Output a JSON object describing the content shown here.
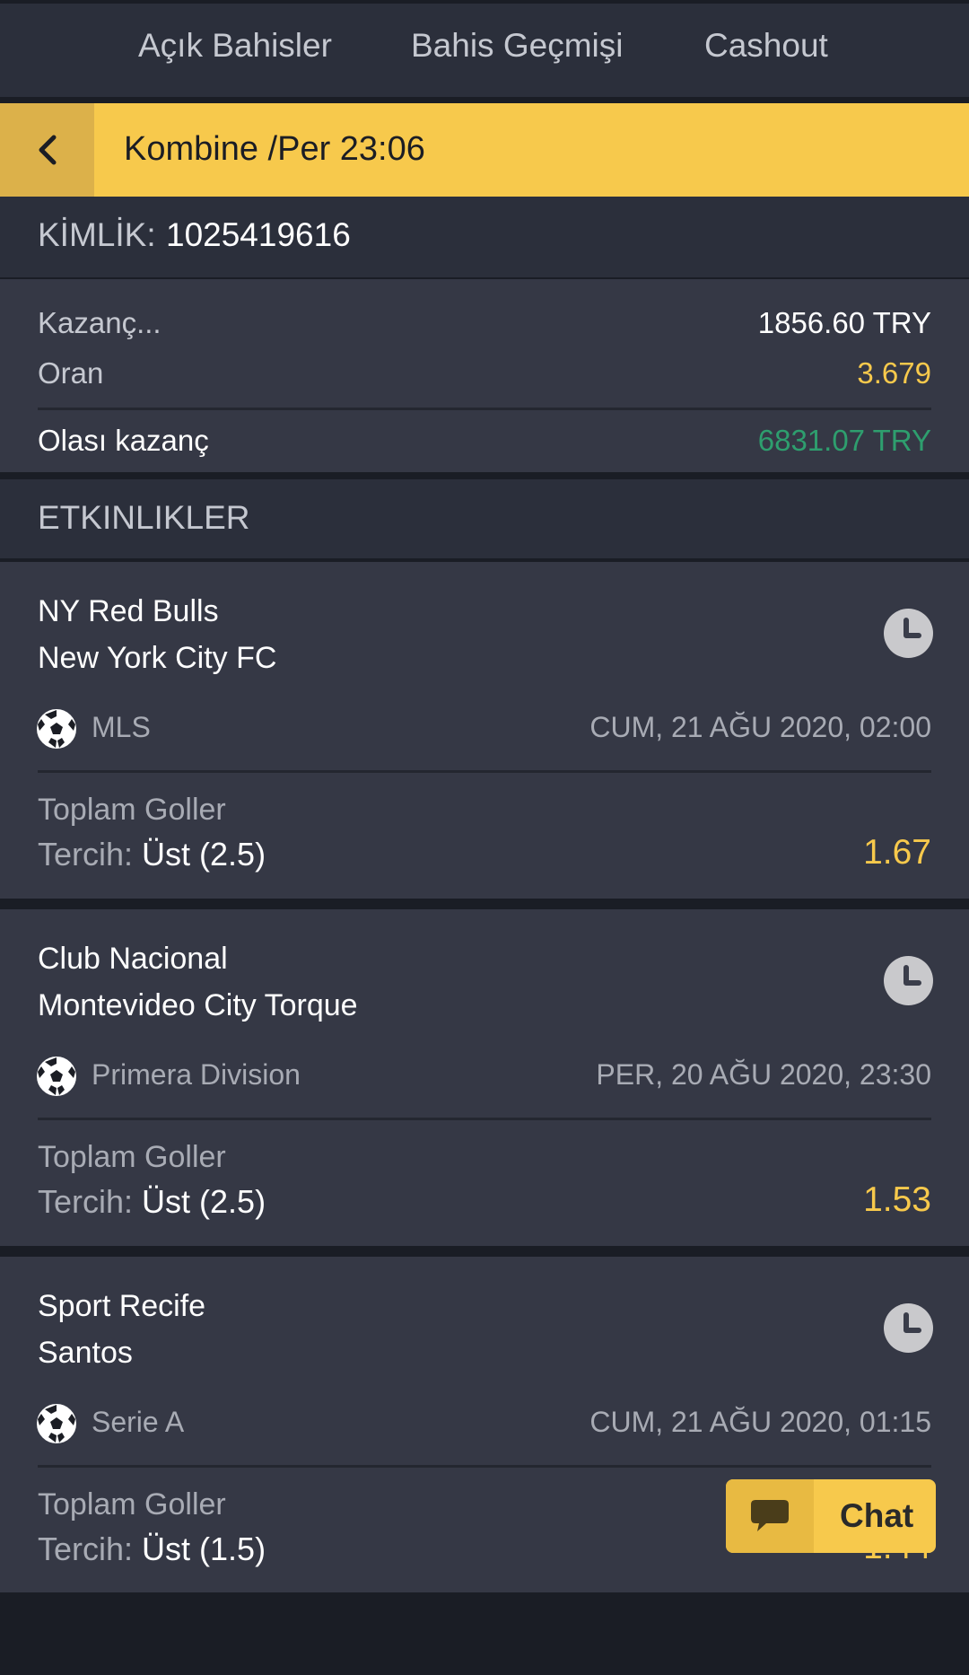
{
  "tabs": [
    "Açık Bahisler",
    "Bahis Geçmişi",
    "Cashout"
  ],
  "header": {
    "title": "Kombine /Per 23:06"
  },
  "id_row": {
    "label": "KİMLİK:",
    "value": "1025419616"
  },
  "summary": {
    "stake_label": "Kazanç...",
    "stake_value": "1856.60 TRY",
    "odds_label": "Oran",
    "odds_value": "3.679",
    "potential_label": "Olası kazanç",
    "potential_value": "6831.07 TRY"
  },
  "events_title": "ETKINLIKLER",
  "pick_prefix": "Tercih:",
  "events": [
    {
      "home": "NY Red Bulls",
      "away": "New York City FC",
      "league": "MLS",
      "date": "CUM, 21 AĞU 2020, 02:00",
      "market": "Toplam Goller",
      "pick": "Üst (2.5)",
      "odds": "1.67"
    },
    {
      "home": "Club Nacional",
      "away": "Montevideo City Torque",
      "league": "Primera Division",
      "date": "PER, 20 AĞU 2020, 23:30",
      "market": "Toplam Goller",
      "pick": "Üst (2.5)",
      "odds": "1.53"
    },
    {
      "home": "Sport Recife",
      "away": "Santos",
      "league": "Serie A",
      "date": "CUM, 21 AĞU 2020, 01:15",
      "market": "Toplam Goller",
      "pick": "Üst (1.5)",
      "odds": "1.44"
    }
  ],
  "chat": {
    "label": "Chat"
  },
  "colors": {
    "accent": "#f7c94c",
    "win": "#2e9e6e",
    "background": "#1a1d25",
    "panel": "#353845"
  },
  "icons": [
    "chevron-left-icon",
    "clock-icon",
    "soccer-ball-icon",
    "chat-bubble-icon"
  ]
}
